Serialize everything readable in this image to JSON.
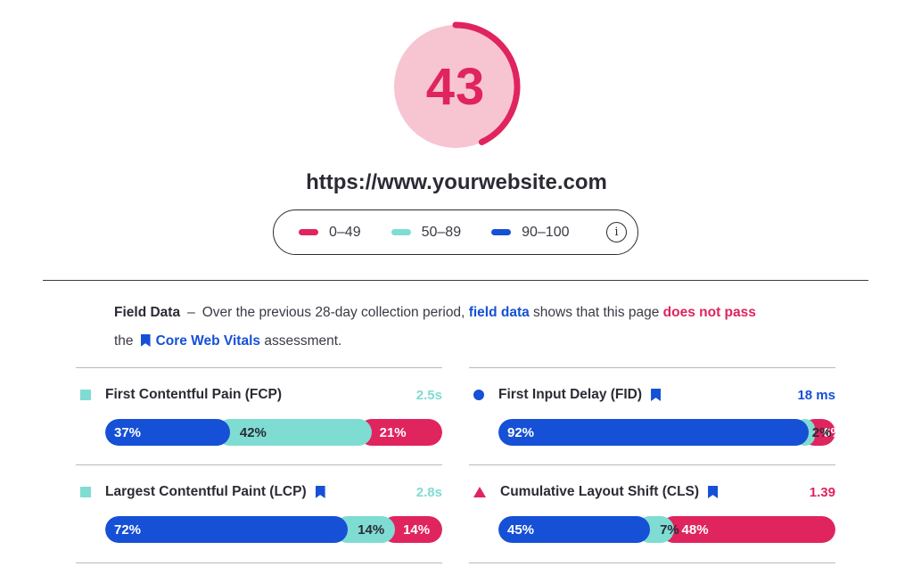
{
  "score": {
    "value": "43",
    "fraction": 0.43,
    "color": "#e0245e",
    "background": "#f7c5d2"
  },
  "url": "https://www.yourwebsite.com",
  "legend": {
    "items": [
      {
        "label": "0–49",
        "color": "#e0245e"
      },
      {
        "label": "50–89",
        "color": "#7fdcd2"
      },
      {
        "label": "90–100",
        "color": "#1550d6"
      }
    ],
    "info_icon": "i"
  },
  "summary": {
    "title": "Field Data",
    "dash": "–",
    "text1": "Over the previous 28-day collection period,",
    "link_field": "field data",
    "text2": "shows that this page",
    "fail_text": "does not pass",
    "text3": "the",
    "link_cwv": "Core Web Vitals",
    "text4": "assessment."
  },
  "metrics": [
    {
      "name": "First Contentful Pain (FCP)",
      "marker": "square",
      "bookmark": false,
      "value": "2.5s",
      "value_color": "#7fdcd2",
      "good": "37%",
      "mid": "42%",
      "poor": "21%",
      "good_pct": 37,
      "mid_pct": 42,
      "poor_pct": 21
    },
    {
      "name": "First Input Delay (FID)",
      "marker": "circle",
      "bookmark": true,
      "value": "18 ms",
      "value_color": "#1550d6",
      "good": "92%",
      "mid": "2%",
      "poor": "6%",
      "good_pct": 92,
      "mid_pct": 2,
      "poor_pct": 6
    },
    {
      "name": "Largest Contentful Paint (LCP)",
      "marker": "square",
      "bookmark": true,
      "value": "2.8s",
      "value_color": "#7fdcd2",
      "good": "72%",
      "mid": "14%",
      "poor": "14%",
      "good_pct": 72,
      "mid_pct": 14,
      "poor_pct": 14
    },
    {
      "name": "Cumulative Layout Shift (CLS)",
      "marker": "triangle",
      "bookmark": true,
      "value": "1.39",
      "value_color": "#e0245e",
      "good": "45%",
      "mid": "7%",
      "poor": "48%",
      "good_pct": 45,
      "mid_pct": 7,
      "poor_pct": 48
    }
  ]
}
